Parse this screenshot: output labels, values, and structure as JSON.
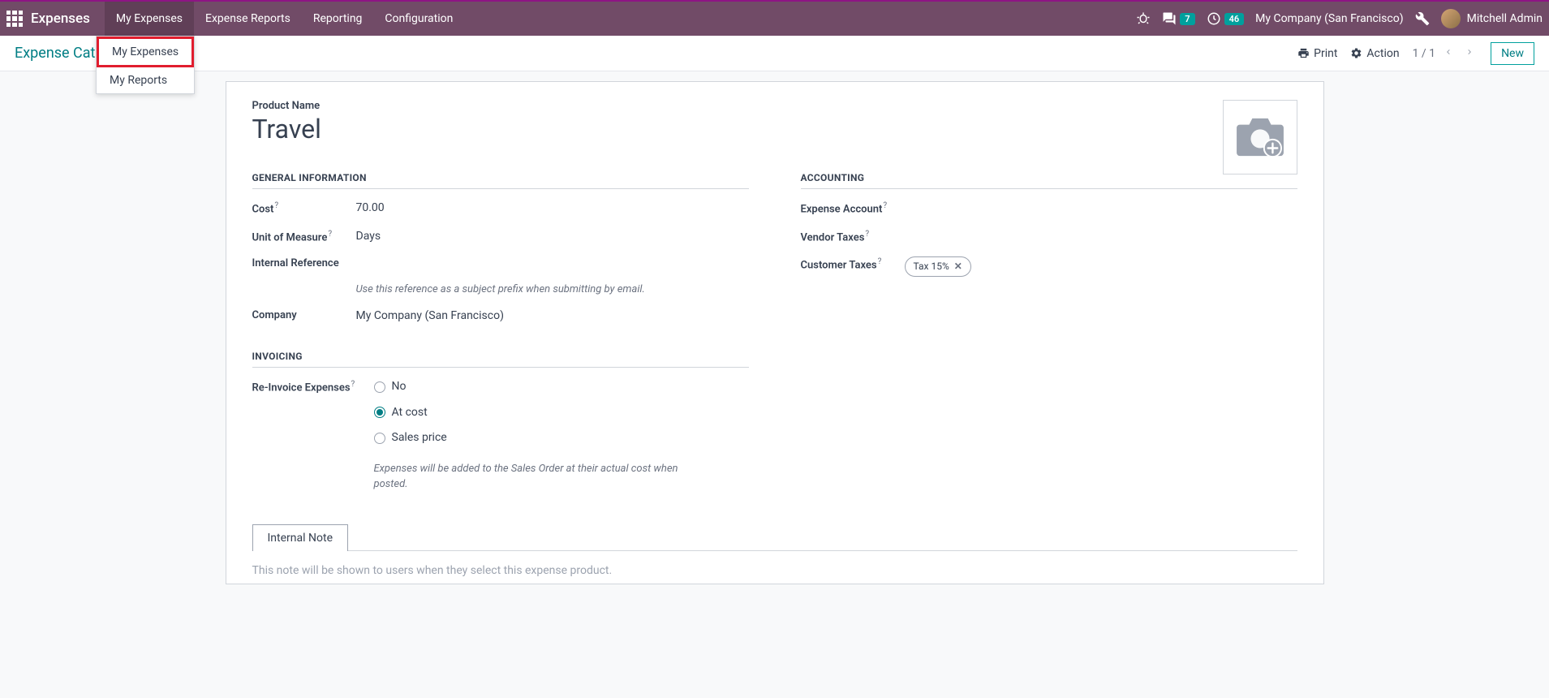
{
  "topbar": {
    "app_title": "Expenses",
    "nav": [
      "My Expenses",
      "Expense Reports",
      "Reporting",
      "Configuration"
    ],
    "messages_count": "7",
    "activities_count": "46",
    "company": "My Company (San Francisco)",
    "user": "Mitchell Admin"
  },
  "dropdown": {
    "items": [
      "My Expenses",
      "My Reports"
    ]
  },
  "control": {
    "breadcrumb": "Expense Cat",
    "print": "Print",
    "action": "Action",
    "pager": "1 / 1",
    "new": "New"
  },
  "form": {
    "product_label": "Product Name",
    "product_name": "Travel",
    "sections": {
      "general": "GENERAL INFORMATION",
      "accounting": "ACCOUNTING",
      "invoicing": "INVOICING"
    },
    "fields": {
      "cost_label": "Cost",
      "cost_value": "70.00",
      "uom_label": "Unit of Measure",
      "uom_value": "Days",
      "internal_ref_label": "Internal Reference",
      "internal_ref_help": "Use this reference as a subject prefix when submitting by email.",
      "company_label": "Company",
      "company_value": "My Company (San Francisco)",
      "reinvoice_label": "Re-Invoice Expenses",
      "reinvoice_options": {
        "no": "No",
        "at_cost": "At cost",
        "sales_price": "Sales price"
      },
      "reinvoice_help": "Expenses will be added to the Sales Order at their actual cost when posted.",
      "expense_account_label": "Expense Account",
      "vendor_taxes_label": "Vendor Taxes",
      "customer_taxes_label": "Customer Taxes",
      "customer_tax_tag": "Tax 15%"
    },
    "tab_label": "Internal Note",
    "note_placeholder": "This note will be shown to users when they select this expense product."
  }
}
